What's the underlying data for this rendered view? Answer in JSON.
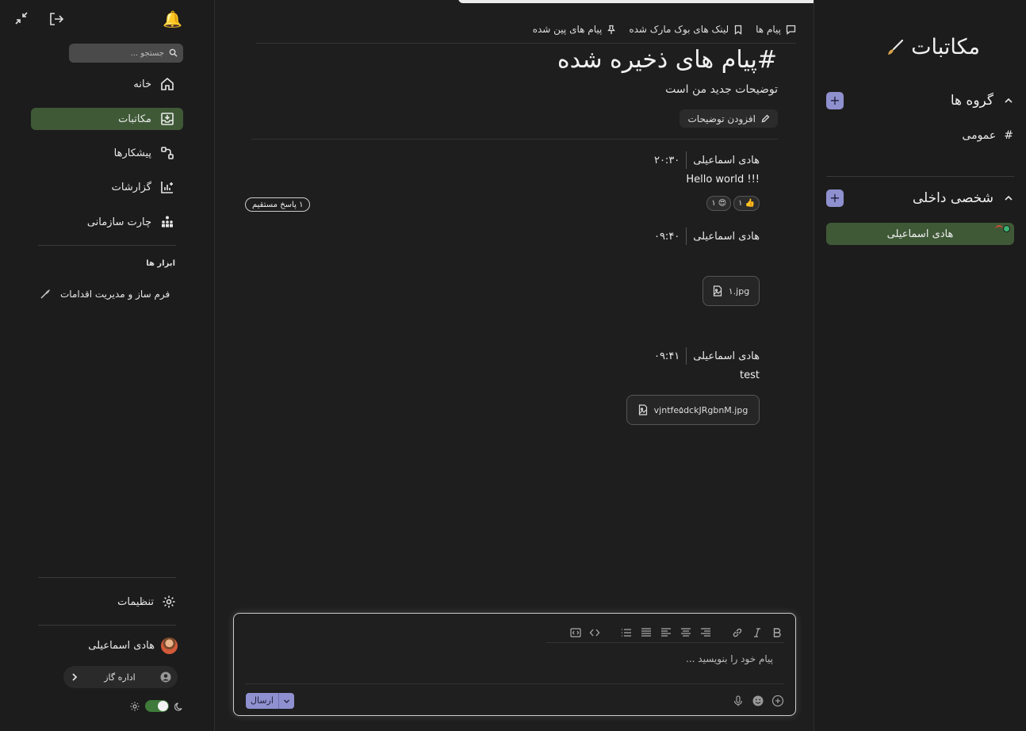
{
  "sidebar": {
    "search_placeholder": "جستجو ...",
    "nav": [
      {
        "label": "خانه",
        "icon": "home-icon"
      },
      {
        "label": "مکاتبات",
        "icon": "inbox-icon",
        "active": true
      },
      {
        "label": "پیشکارها",
        "icon": "workflow-icon"
      },
      {
        "label": "گزارشات",
        "icon": "chart-icon"
      },
      {
        "label": "چارت سازمانی",
        "icon": "org-chart-icon"
      }
    ],
    "tools_title": "ابزار ها",
    "tools": [
      {
        "label": "فرم ساز و مدیریت اقدامات",
        "icon": "feather-icon"
      }
    ],
    "settings_label": "تنظیمات",
    "user_name": "هادی اسماعیلی",
    "org_label": "اداره گاز"
  },
  "main": {
    "tabs": [
      "پیام ها",
      "لینک های بوک مارک شده",
      "پیام های پین شده"
    ],
    "channel_title": "پیام های ذخیره شده",
    "channel_prefix": "#",
    "channel_description": "توضیحات جدید من است",
    "add_description_label": "افزودن توضیحات",
    "messages": [
      {
        "author": "هادی اسماعیلی",
        "time": "۲۰:۳۰",
        "text": "Hello world !!!"
      },
      {
        "author": "هادی اسماعیلی",
        "time": "۰۹:۴۰",
        "file": "۱.jpg"
      },
      {
        "author": "هادی اسماعیلی",
        "time": "۰۹:۴۱",
        "text": "test",
        "file": "vjntfe۵dckJRgbnM.jpg"
      }
    ],
    "reactions": [
      {
        "emoji": "👍",
        "count": "۱"
      },
      {
        "emoji": "😍",
        "count": "۱"
      }
    ],
    "thread_label": "۱ پاسخ مستقیم",
    "composer": {
      "placeholder": "پیام خود را بنویسید ...",
      "send_label": "ارسال"
    }
  },
  "right_panel": {
    "title": "مکاتبات",
    "groups_label": "گروه ها",
    "channels": [
      {
        "prefix": "#",
        "name": "عمومی"
      }
    ],
    "direct_label": "شخصی داخلی",
    "direct_users": [
      "هادی اسماعیلی"
    ]
  },
  "colors": {
    "accent": "#8f90cf",
    "active_bg": "#3f5937",
    "background": "#1e1e1e"
  }
}
